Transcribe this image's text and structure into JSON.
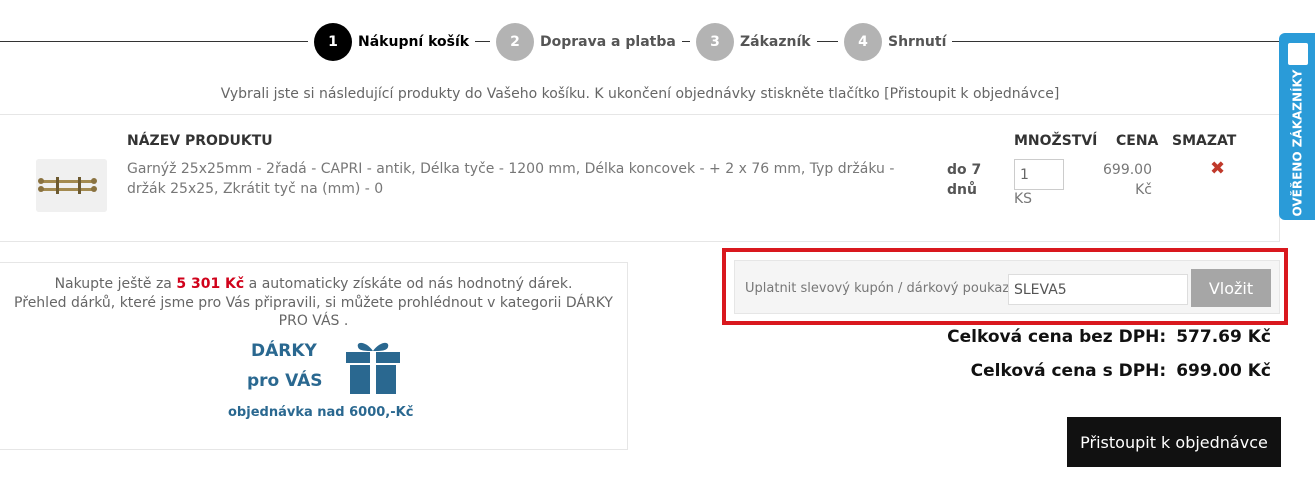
{
  "steps": [
    {
      "num": "1",
      "label": "Nákupní košík",
      "active": true
    },
    {
      "num": "2",
      "label": "Doprava a platba",
      "active": false
    },
    {
      "num": "3",
      "label": "Zákazník",
      "active": false
    },
    {
      "num": "4",
      "label": "Shrnutí",
      "active": false
    }
  ],
  "intro": "Vybrali jste si následující produkty do Vašeho košíku. K ukončení objednávky stiskněte tlačítko [Přistoupit k objednávce]",
  "cart": {
    "headers": {
      "name": "NÁZEV PRODUKTU",
      "qty": "MNOŽSTVÍ",
      "price": "CENA",
      "delete": "SMAZAT"
    },
    "items": [
      {
        "name": "Garnýž 25x25mm - 2řadá - CAPRI - antik, Délka tyče - 1200 mm, Délka koncovek - + 2 x 76 mm, Typ držáku - držák 25x25, Zkrátit tyč na (mm) - 0",
        "delivery": "do 7 dnů",
        "qty": "1",
        "unit": "KS",
        "price": "699.00 Kč",
        "delete_icon": "close-x-icon"
      }
    ]
  },
  "gift": {
    "line1_before": "Nakupte ještě za ",
    "amount": "5 301 Kč",
    "line1_after": " a automaticky získáte od nás hodnotný dárek.",
    "line2": "Přehled dárků, které jsme pro Vás připravili, si můžete prohlédnout v kategorii DÁRKY PRO VÁS .",
    "banner_t1": "DÁRKY",
    "banner_t2": "pro VÁS",
    "banner_t3": "objednávka nad 6000,-Kč",
    "banner_icon": "gift-icon",
    "accent_color": "#2a6890"
  },
  "coupon": {
    "label": "Uplatnit slevový kupón / dárkový poukaz",
    "value": "SLEVA5",
    "button": "Vložit",
    "highlight_color": "#d9181e"
  },
  "totals": {
    "without_vat_label": "Celková cena bez DPH:",
    "without_vat_value": "577.69 Kč",
    "with_vat_label": "Celková cena s DPH:",
    "with_vat_value": "699.00 Kč"
  },
  "checkout_button": "Přistoupit k objednávce",
  "verified_tab": {
    "label": "OVĚŘENO ZÁKAZNÍKY",
    "color": "#2a9bd8"
  }
}
